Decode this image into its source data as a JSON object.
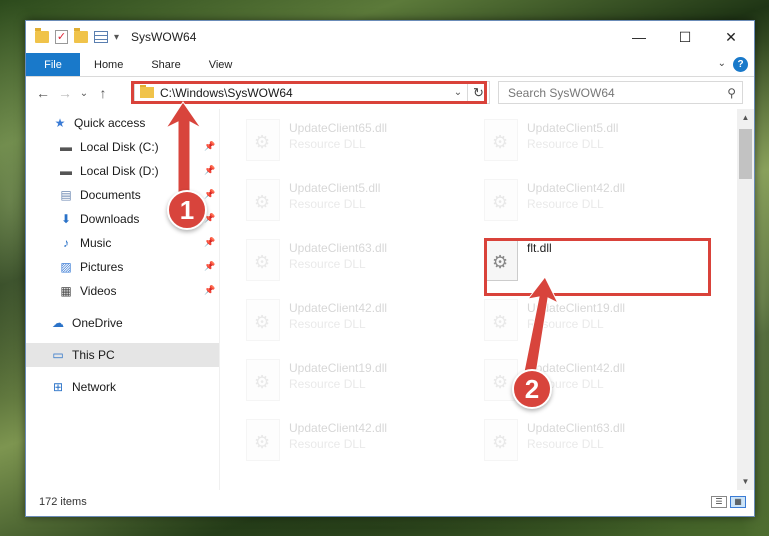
{
  "window": {
    "title": "SysWOW64"
  },
  "ribbon": {
    "tabs": [
      "File",
      "Home",
      "Share",
      "View"
    ],
    "help": "?"
  },
  "nav": {
    "back": "←",
    "forward": "→",
    "recent": "⌄",
    "up": "↑"
  },
  "address": {
    "path": "C:\\Windows\\SysWOW64"
  },
  "search": {
    "placeholder": "Search SysWOW64"
  },
  "sidebar": {
    "items": [
      {
        "label": "Quick access",
        "icon": "star-icon"
      },
      {
        "label": "Local Disk (C:)",
        "icon": "drive-icon"
      },
      {
        "label": "Local Disk (D:)",
        "icon": "drive-icon"
      },
      {
        "label": "Documents",
        "icon": "document-icon"
      },
      {
        "label": "Downloads",
        "icon": "download-icon"
      },
      {
        "label": "Music",
        "icon": "music-icon"
      },
      {
        "label": "Pictures",
        "icon": "pictures-icon"
      },
      {
        "label": "Videos",
        "icon": "videos-icon"
      },
      {
        "label": "OneDrive",
        "icon": "cloud-icon"
      },
      {
        "label": "This PC",
        "icon": "pc-icon"
      },
      {
        "label": "Network",
        "icon": "network-icon"
      }
    ]
  },
  "files": {
    "left": [
      {
        "name": "UpdateClient65.dll",
        "type": "Resource DLL"
      },
      {
        "name": "UpdateClient5.dll",
        "type": "Resource DLL"
      },
      {
        "name": "UpdateClient63.dll",
        "type": "Resource DLL"
      },
      {
        "name": "UpdateClient42.dll",
        "type": "Resource DLL"
      },
      {
        "name": "UpdateClient19.dll",
        "type": "Resource DLL"
      },
      {
        "name": "UpdateClient42.dll",
        "type": "Resource DLL"
      }
    ],
    "right": [
      {
        "name": "UpdateClient5.dll",
        "type": "Resource DLL"
      },
      {
        "name": "UpdateClient42.dll",
        "type": "Resource DLL"
      },
      {
        "name": "flt.dll",
        "type": ""
      },
      {
        "name": "UpdateClient19.dll",
        "type": "Resource DLL"
      },
      {
        "name": "UpdateClient42.dll",
        "type": "Resource DLL"
      },
      {
        "name": "UpdateClient63.dll",
        "type": "Resource DLL"
      }
    ]
  },
  "status": {
    "count": "172 items"
  },
  "annotations": {
    "one": "1",
    "two": "2"
  }
}
